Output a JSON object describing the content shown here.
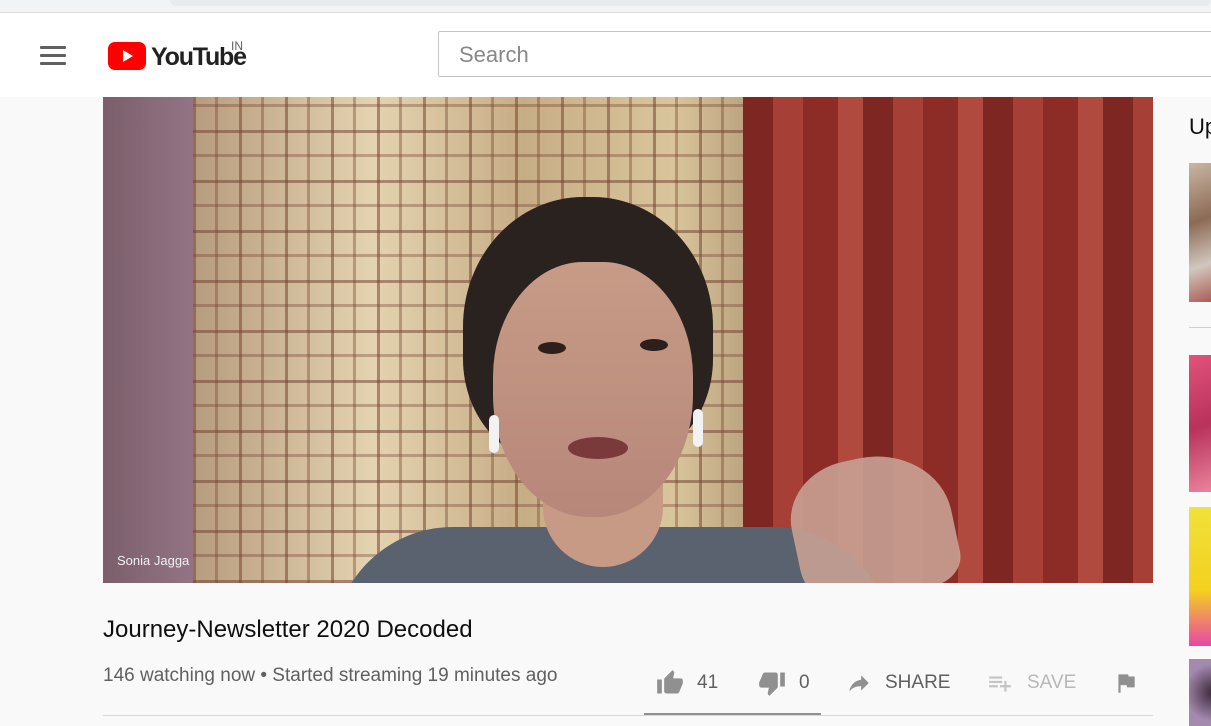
{
  "masthead": {
    "logo_text": "YouTube",
    "country_code": "IN",
    "search_placeholder": "Search"
  },
  "player": {
    "name_tag": "Sonia Jagga"
  },
  "video": {
    "title": "Journey-Newsletter 2020 Decoded",
    "meta": "146 watching now • Started streaming 19 minutes ago"
  },
  "actions": {
    "like_count": "41",
    "dislike_count": "0",
    "share_label": "SHARE",
    "save_label": "SAVE"
  },
  "sidebar": {
    "up_next_label": "Up next"
  },
  "colors": {
    "brand_red": "#ff0000",
    "text_primary": "#0f0f0f",
    "text_secondary": "#606060",
    "icon_gray": "#909090"
  }
}
